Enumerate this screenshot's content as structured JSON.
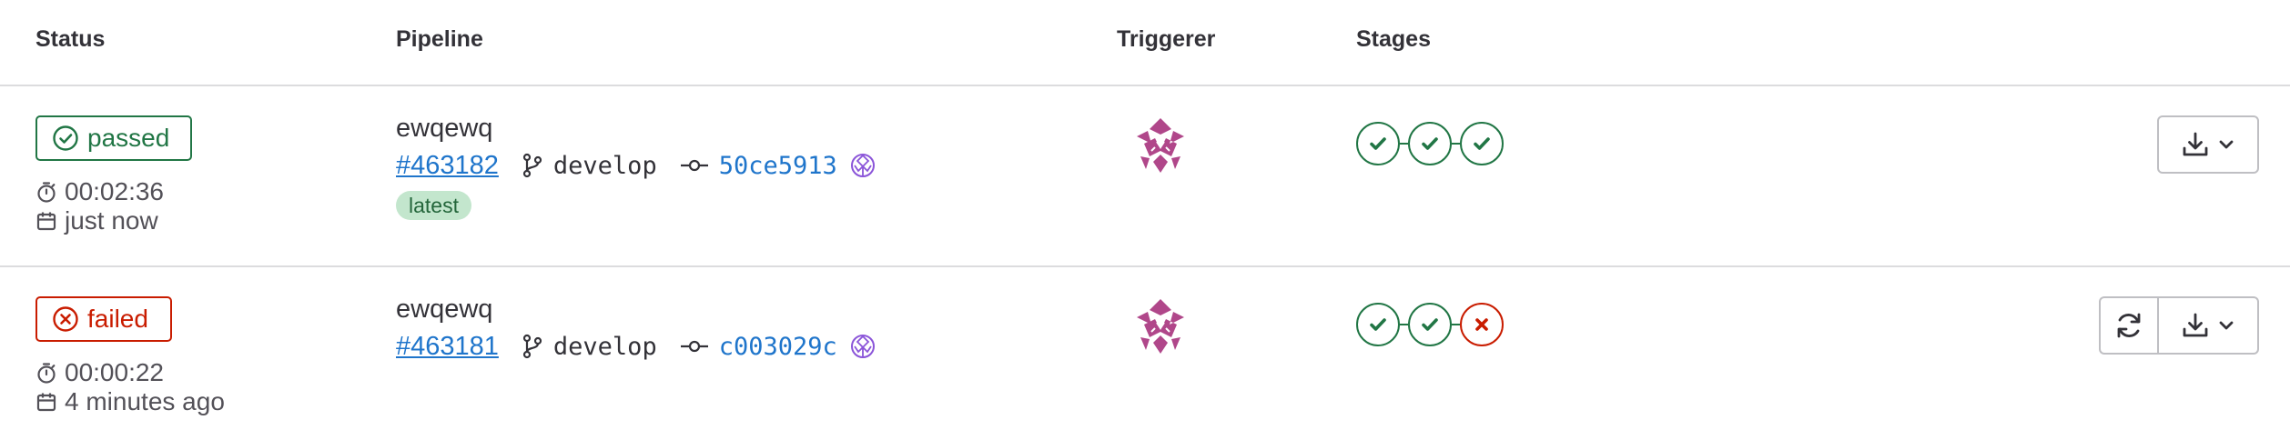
{
  "columns": {
    "status": "Status",
    "pipeline": "Pipeline",
    "triggerer": "Triggerer",
    "stages": "Stages"
  },
  "rows": [
    {
      "status": "passed",
      "duration": "00:02:36",
      "finished": "just now",
      "title": "ewqewq",
      "pipeline_id": "#463182",
      "branch": "develop",
      "commit_sha": "50ce5913",
      "tag": "latest",
      "stages": [
        "success",
        "success",
        "success"
      ],
      "actions": [
        "download-artifacts"
      ]
    },
    {
      "status": "failed",
      "duration": "00:00:22",
      "finished": "4 minutes ago",
      "title": "ewqewq",
      "pipeline_id": "#463181",
      "branch": "develop",
      "commit_sha": "c003029c",
      "stages": [
        "success",
        "success",
        "failed"
      ],
      "actions": [
        "retry",
        "download-artifacts"
      ]
    }
  ],
  "colors": {
    "success": "#217645",
    "failed": "#c91c00",
    "link": "#1f75cb",
    "avatar": "#b0478a",
    "tag_bg": "#c3e6cd"
  },
  "icons": [
    "status-success-icon",
    "status-failed-icon",
    "timer-icon",
    "calendar-icon",
    "branch-icon",
    "commit-icon",
    "check-icon",
    "close-icon",
    "download-icon",
    "chevron-down-icon",
    "retry-icon"
  ]
}
